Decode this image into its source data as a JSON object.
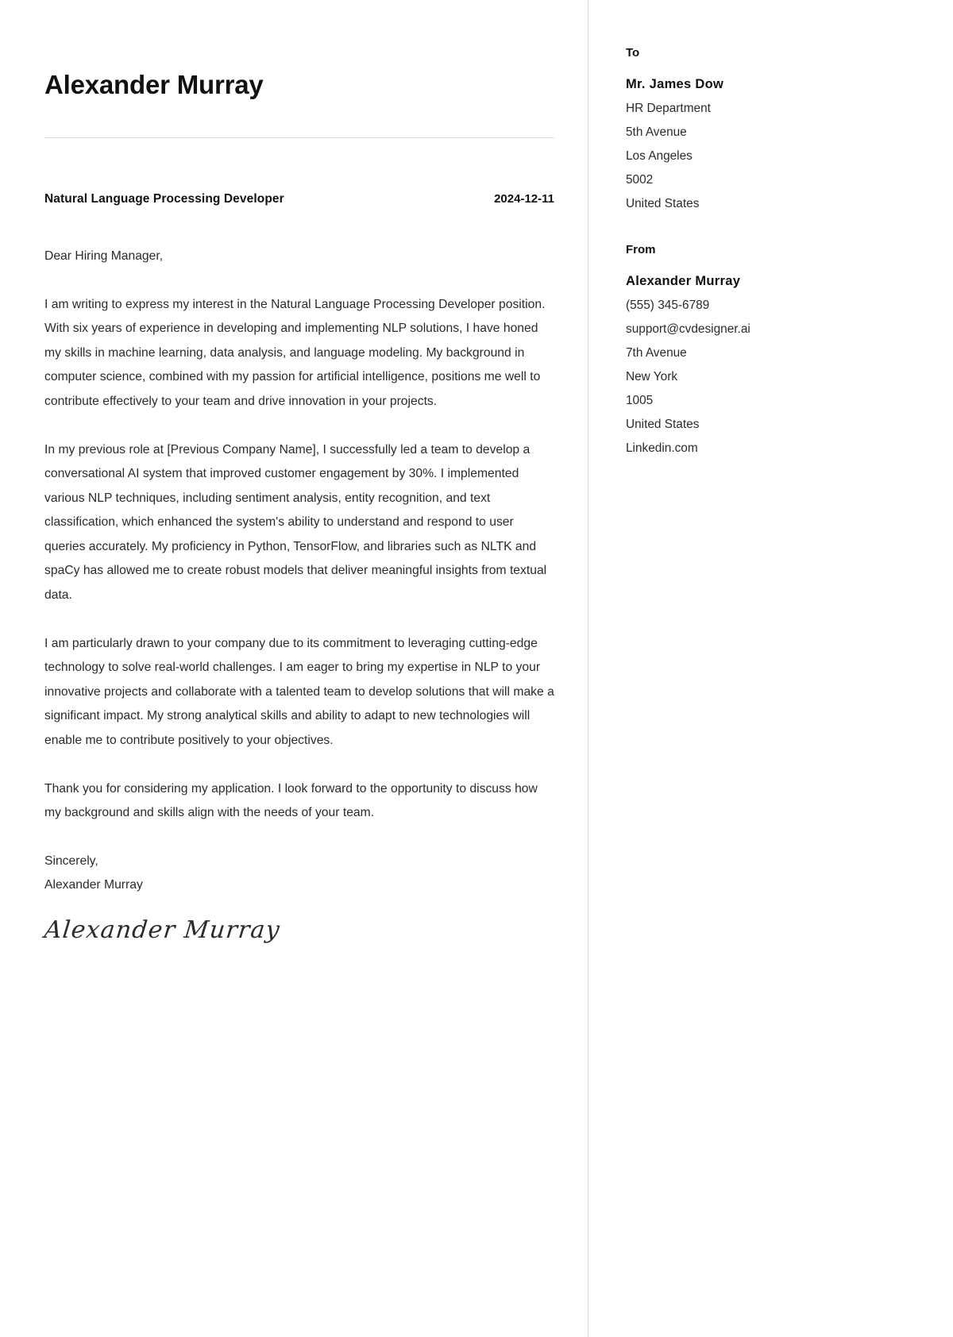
{
  "letter": {
    "name": "Alexander Murray",
    "subject": "Natural Language Processing Developer",
    "date": "2024-12-11",
    "salutation": "Dear Hiring Manager,",
    "paragraphs": [
      "I am writing to express my interest in the Natural Language Processing Developer position. With six years of experience in developing and implementing NLP solutions, I have honed my skills in machine learning, data analysis, and language modeling. My background in computer science, combined with my passion for artificial intelligence, positions me well to contribute effectively to your team and drive innovation in your projects.",
      "In my previous role at [Previous Company Name], I successfully led a team to develop a conversational AI system that improved customer engagement by 30%. I implemented various NLP techniques, including sentiment analysis, entity recognition, and text classification, which enhanced the system's ability to understand and respond to user queries accurately. My proficiency in Python, TensorFlow, and libraries such as NLTK and spaCy has allowed me to create robust models that deliver meaningful insights from textual data.",
      "I am particularly drawn to your company due to its commitment to leveraging cutting-edge technology to solve real-world challenges. I am eager to bring my expertise in NLP to your innovative projects and collaborate with a talented team to develop solutions that will make a significant impact. My strong analytical skills and ability to adapt to new technologies will enable me to contribute positively to your objectives.",
      "Thank you for considering my application. I look forward to the opportunity to discuss how my background and skills align with the needs of your team."
    ],
    "closing_word": "Sincerely,",
    "closing_name": "Alexander Murray",
    "signature": "Alexander Murray"
  },
  "sidebar": {
    "to": {
      "heading": "To",
      "name": "Mr. James Dow",
      "lines": [
        "HR Department",
        "5th Avenue",
        "Los Angeles",
        "5002",
        "United States"
      ]
    },
    "from": {
      "heading": "From",
      "name": "Alexander Murray",
      "lines": [
        "(555) 345-6789",
        "support@cvdesigner.ai",
        "7th Avenue",
        "New York",
        "1005",
        "United States",
        "Linkedin.com"
      ]
    }
  }
}
